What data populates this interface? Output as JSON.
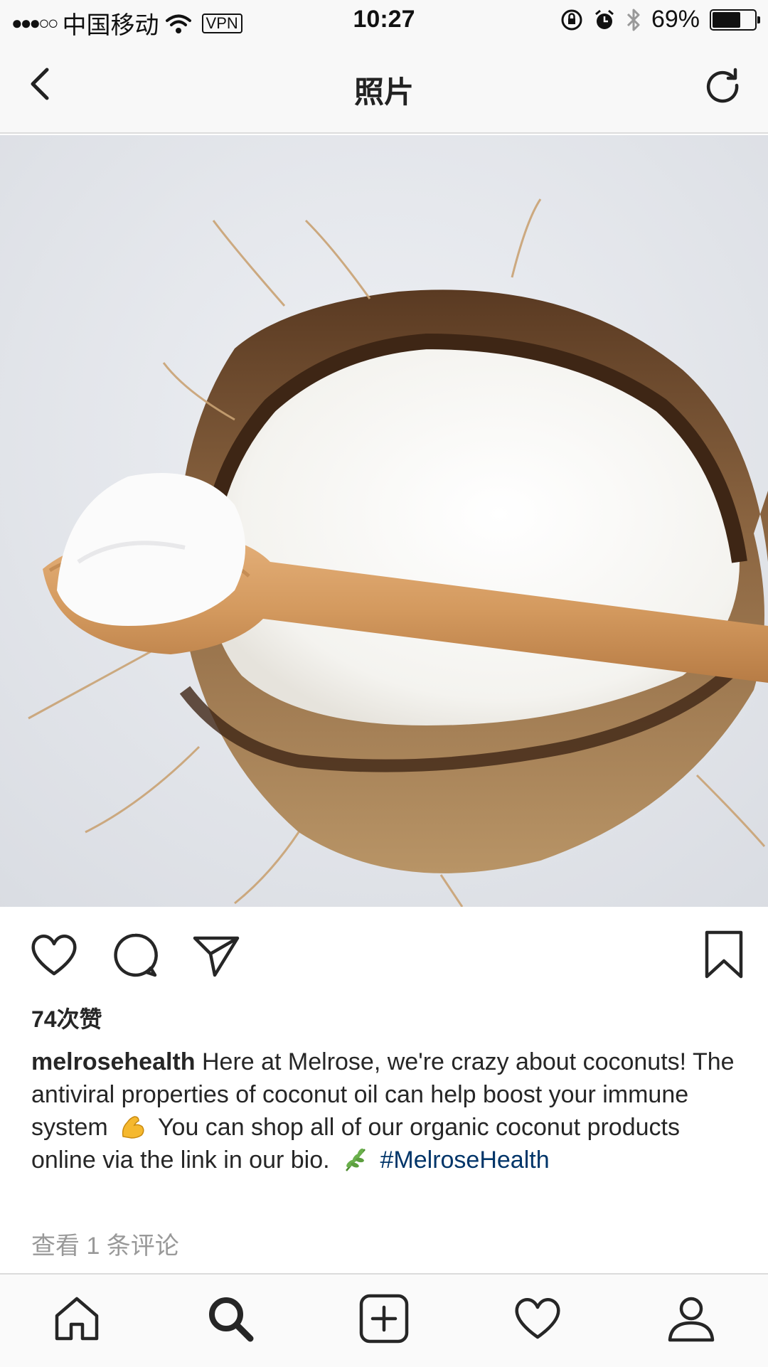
{
  "status_bar": {
    "signal": "●●●○○",
    "carrier": "中国移动",
    "vpn": "VPN",
    "time": "10:27",
    "battery": "69%",
    "battery_level": 0.69
  },
  "nav": {
    "title": "照片"
  },
  "post": {
    "likes": "74次赞",
    "username": "melrosehealth",
    "caption_part1": " Here at Melrose, we're crazy about coconuts! The antiviral properties of coconut oil can help boost your immune system",
    "caption_part2": " You can shop all of our organic coconut products online via the link in our bio.",
    "hashtag": "#MelroseHealth",
    "view_comments": "查看 1 条评论"
  },
  "icons": {
    "back": "chevron-left-icon",
    "refresh": "refresh-icon",
    "like": "heart-icon",
    "comment": "comment-icon",
    "share": "paper-plane-icon",
    "save": "bookmark-icon",
    "home": "home-icon",
    "search": "search-icon",
    "add": "plus-square-icon",
    "activity": "heart-icon",
    "profile": "profile-icon"
  },
  "colors": {
    "hashtag": "#003569",
    "text": "#262626",
    "muted": "#999999"
  }
}
